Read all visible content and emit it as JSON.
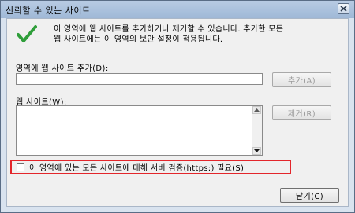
{
  "window": {
    "title": "신뢰할 수 있는 사이트"
  },
  "info": {
    "line1": "이 영역에 웹 사이트를 추가하거나 제거할 수 있습니다. 추가한 모든",
    "line2": "웹 사이트에는 이 영역의 보안 설정이 적용됩니다."
  },
  "add_site": {
    "label": "영역에 웹 사이트 추가(D):",
    "value": "",
    "button": "추가(A)"
  },
  "sites": {
    "label": "웹 사이트(W):",
    "items": [],
    "remove_button": "제거(R)"
  },
  "https_check": {
    "label": "이 영역에 있는 모든 사이트에 대해 서버 검증(https:) 필요(S)",
    "checked": false
  },
  "footer": {
    "close_button": "닫기(C)"
  },
  "icons": {
    "status": "checkmark-icon",
    "window_close": "close-icon",
    "scroll_up": "scroll-up-icon",
    "scroll_down": "scroll-down-icon"
  },
  "colors": {
    "highlight_border": "#e3262b",
    "checkmark": "#2f9e3a"
  }
}
